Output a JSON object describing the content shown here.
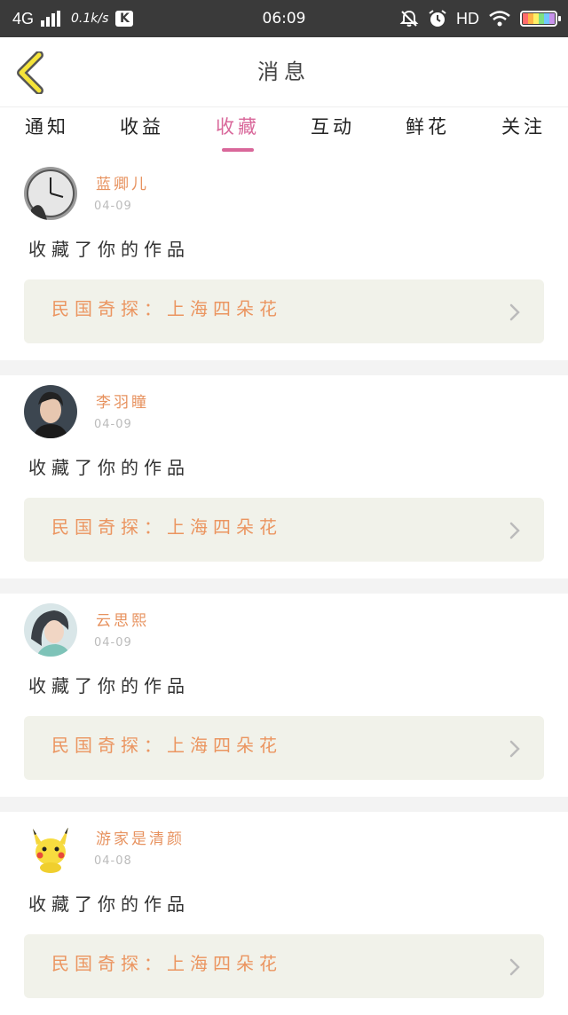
{
  "status_bar": {
    "network": "4G",
    "speed": "0.1k/s",
    "app_badge": "K",
    "time": "06:09",
    "hd": "HD"
  },
  "header": {
    "title": "消息",
    "back_icon": "chevron-left-icon"
  },
  "tabs": [
    {
      "label": "通知",
      "active": false
    },
    {
      "label": "收益",
      "active": false
    },
    {
      "label": "收藏",
      "active": true
    },
    {
      "label": "互动",
      "active": false
    },
    {
      "label": "鲜花",
      "active": false
    },
    {
      "label": "关注",
      "active": false
    }
  ],
  "messages": [
    {
      "name": "蓝卿儿",
      "date": "04-09",
      "action": "收藏了你的作品",
      "work": "民国奇探：上海四朵花",
      "avatar": "clock-avatar"
    },
    {
      "name": "李羽瞳",
      "date": "04-09",
      "action": "收藏了你的作品",
      "work": "民国奇探：上海四朵花",
      "avatar": "man-portrait-avatar"
    },
    {
      "name": "云思熙",
      "date": "04-09",
      "action": "收藏了你的作品",
      "work": "民国奇探：上海四朵花",
      "avatar": "girl-portrait-avatar"
    },
    {
      "name": "游家是清颜",
      "date": "04-08",
      "action": "收藏了你的作品",
      "work": "民国奇探：上海四朵花",
      "avatar": "pikachu-avatar"
    }
  ],
  "colors": {
    "accent": "#d9679a",
    "username": "#e7925f",
    "work_title": "#eb9560",
    "work_bg": "#f1f2ea",
    "statusbar": "#3a3a3a"
  }
}
